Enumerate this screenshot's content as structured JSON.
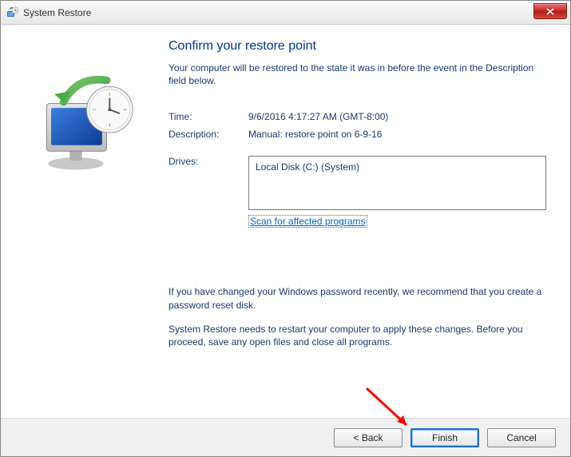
{
  "window": {
    "title": "System Restore"
  },
  "main": {
    "heading": "Confirm your restore point",
    "intro": "Your computer will be restored to the state it was in before the event in the Description field below.",
    "time_label": "Time:",
    "time_value": "9/6/2016 4:17:27 AM (GMT-8:00)",
    "description_label": "Description:",
    "description_value": "Manual: restore point on 6-9-16",
    "drives_label": "Drives:",
    "drives_list": "Local Disk (C:) (System)",
    "scan_link": "Scan for affected programs",
    "note1": "If you have changed your Windows password recently, we recommend that you create a password reset disk.",
    "note2": "System Restore needs to restart your computer to apply these changes. Before you proceed, save any open files and close all programs."
  },
  "footer": {
    "back": "< Back",
    "finish": "Finish",
    "cancel": "Cancel"
  }
}
